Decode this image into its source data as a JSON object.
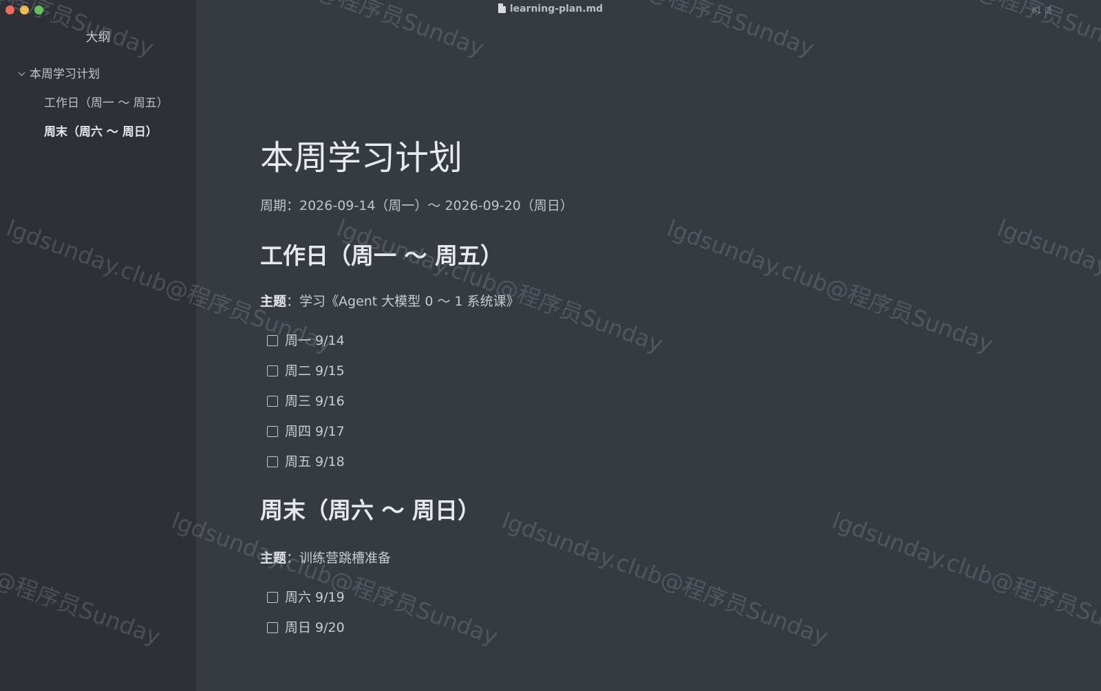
{
  "window": {
    "filename": "learning-plan.md",
    "word_count": "81 词"
  },
  "sidebar": {
    "title": "大纲",
    "items": [
      {
        "label": "本周学习计划"
      },
      {
        "label": "工作日（周一 ～ 周五）"
      },
      {
        "label": "周末（周六 ～ 周日）"
      }
    ]
  },
  "document": {
    "title": "本周学习计划",
    "period": "周期：2026-09-14（周一）～ 2026-09-20（周日）",
    "weekdays": {
      "heading": "工作日（周一 ～ 周五）",
      "theme_label": "主题",
      "theme_value": "：学习《Agent 大模型 0 ～ 1 系统课》",
      "tasks": [
        "周一 9/14",
        "周二 9/15",
        "周三 9/16",
        "周四 9/17",
        "周五 9/18"
      ]
    },
    "weekend": {
      "heading": "周末（周六 ～ 周日）",
      "theme_label": "主题",
      "theme_value": "：训练营跳槽准备",
      "tasks": [
        "周六 9/19",
        "周日 9/20"
      ]
    }
  },
  "watermark": {
    "text": "lgdsunday.club@程序员Sunday"
  }
}
